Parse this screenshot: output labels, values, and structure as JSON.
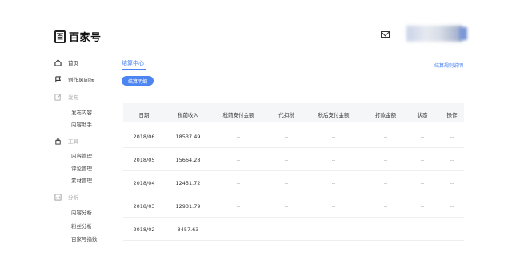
{
  "header": {
    "logo_mark": "百",
    "logo_text": "百家号"
  },
  "sidebar": {
    "home": "首页",
    "creator": "创作风向标",
    "publish_group": "发布",
    "publish_items": [
      "发布内容",
      "内容助手"
    ],
    "tools_group": "工具",
    "tools_items": [
      "内容管理",
      "评论管理",
      "素材管理"
    ],
    "analysis_group": "分析",
    "analysis_items": [
      "内容分析",
      "粉丝分析",
      "百家号指数"
    ]
  },
  "main": {
    "tab_label": "结算中心",
    "detail_button": "结算明细",
    "rule_link": "结算规则说明",
    "table": {
      "headers": [
        "日期",
        "税前收入",
        "税前支付金额",
        "代扣税",
        "税后支付金额",
        "打款金额",
        "状态",
        "操作"
      ],
      "rows": [
        [
          "2018/06",
          "18537.49",
          "--",
          "--",
          "--",
          "--",
          "--",
          "--"
        ],
        [
          "2018/05",
          "15664.28",
          "--",
          "--",
          "--",
          "--",
          "--",
          "--"
        ],
        [
          "2018/04",
          "12451.72",
          "--",
          "--",
          "--",
          "--",
          "--",
          "--"
        ],
        [
          "2018/03",
          "12931.79",
          "--",
          "--",
          "--",
          "--",
          "--",
          "--"
        ],
        [
          "2018/02",
          "8457.63",
          "--",
          "--",
          "--",
          "--",
          "--",
          "--"
        ]
      ]
    }
  },
  "colors": {
    "accent": "#4c84f3",
    "header_bg": "#f5f6f8"
  }
}
